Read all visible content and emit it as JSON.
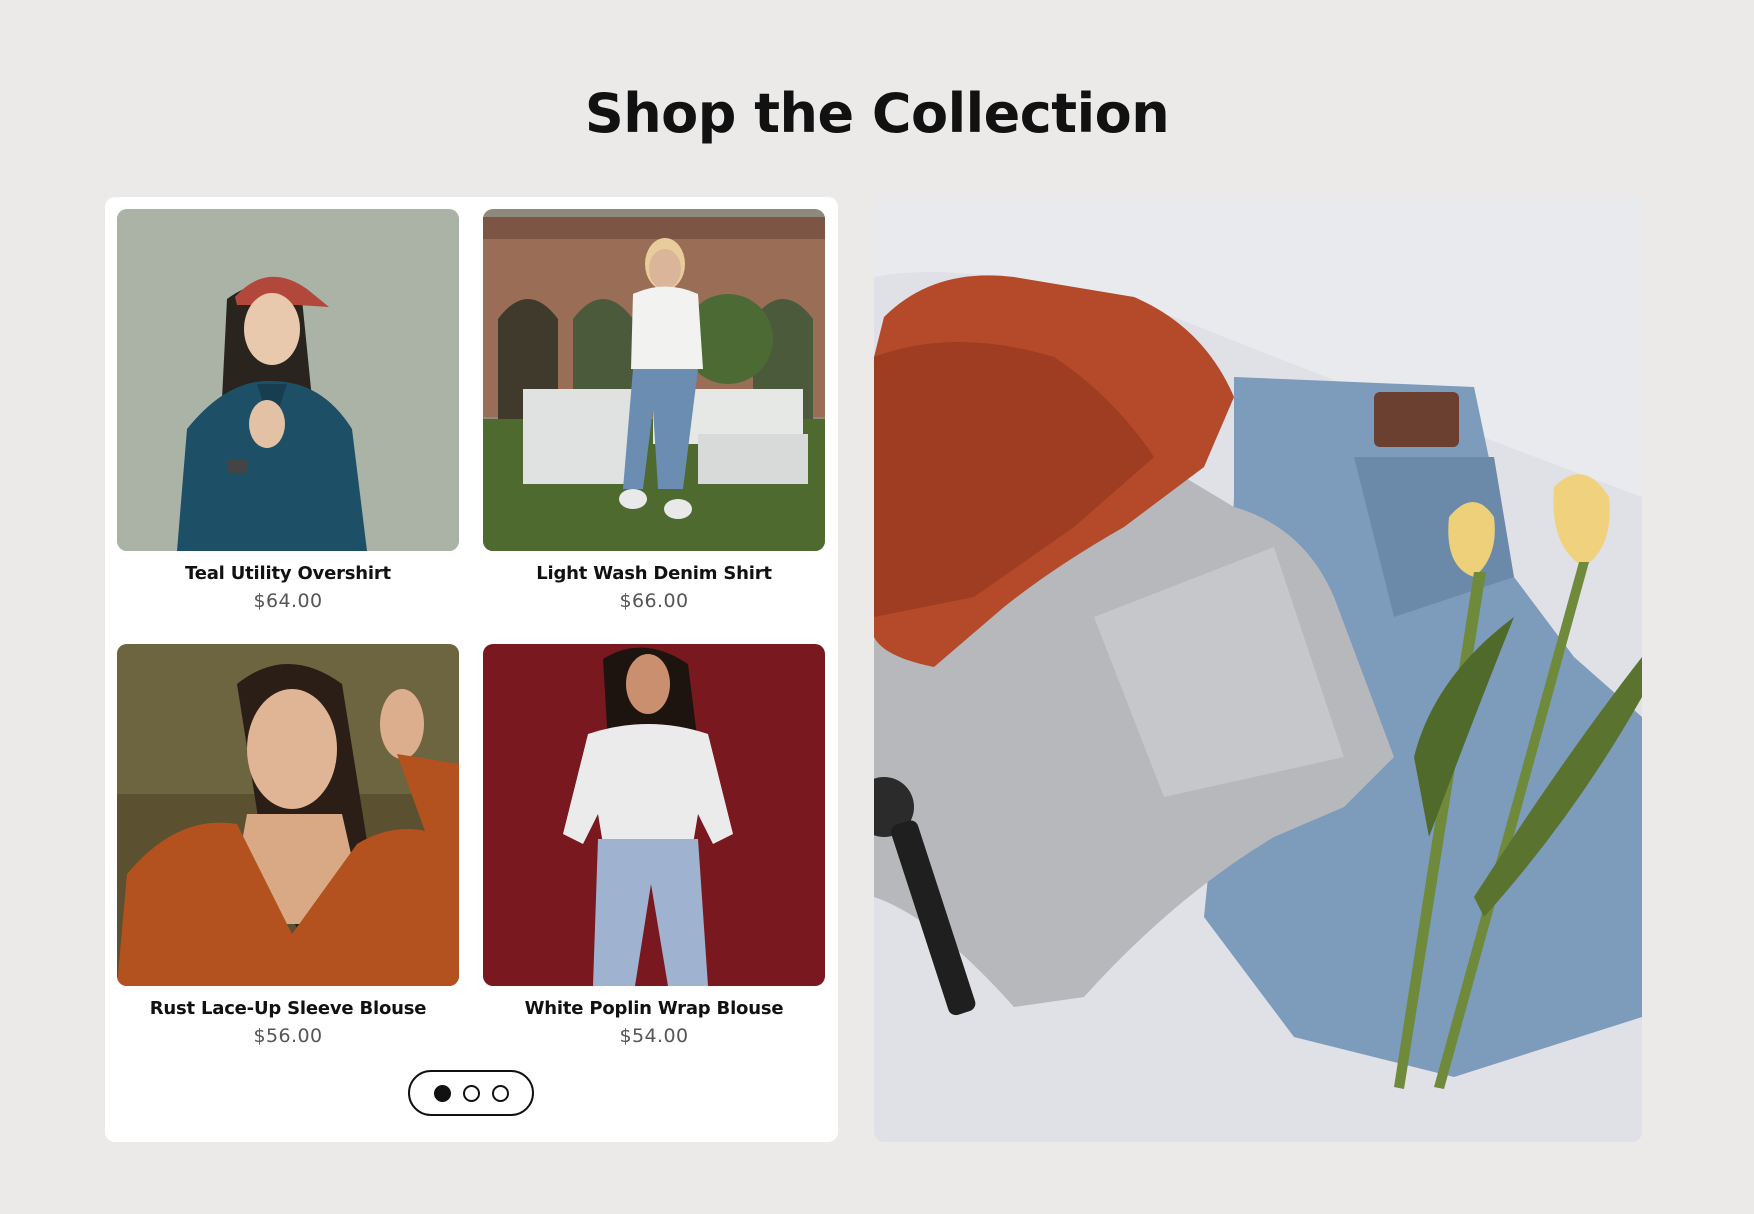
{
  "section": {
    "title": "Shop the Collection"
  },
  "products": [
    {
      "name": "Teal Utility Overshirt",
      "price": "$64.00"
    },
    {
      "name": "Light Wash Denim Shirt",
      "price": "$66.00"
    },
    {
      "name": "Rust Lace-Up Sleeve Blouse",
      "price": "$56.00"
    },
    {
      "name": "White Poplin Wrap Blouse",
      "price": "$54.00"
    }
  ],
  "pagination": {
    "pages": 3,
    "current": 1
  },
  "colors": {
    "page_bg": "#ebeae8",
    "card_bg": "#ffffff",
    "text_primary": "#111111",
    "text_price": "#555555"
  }
}
